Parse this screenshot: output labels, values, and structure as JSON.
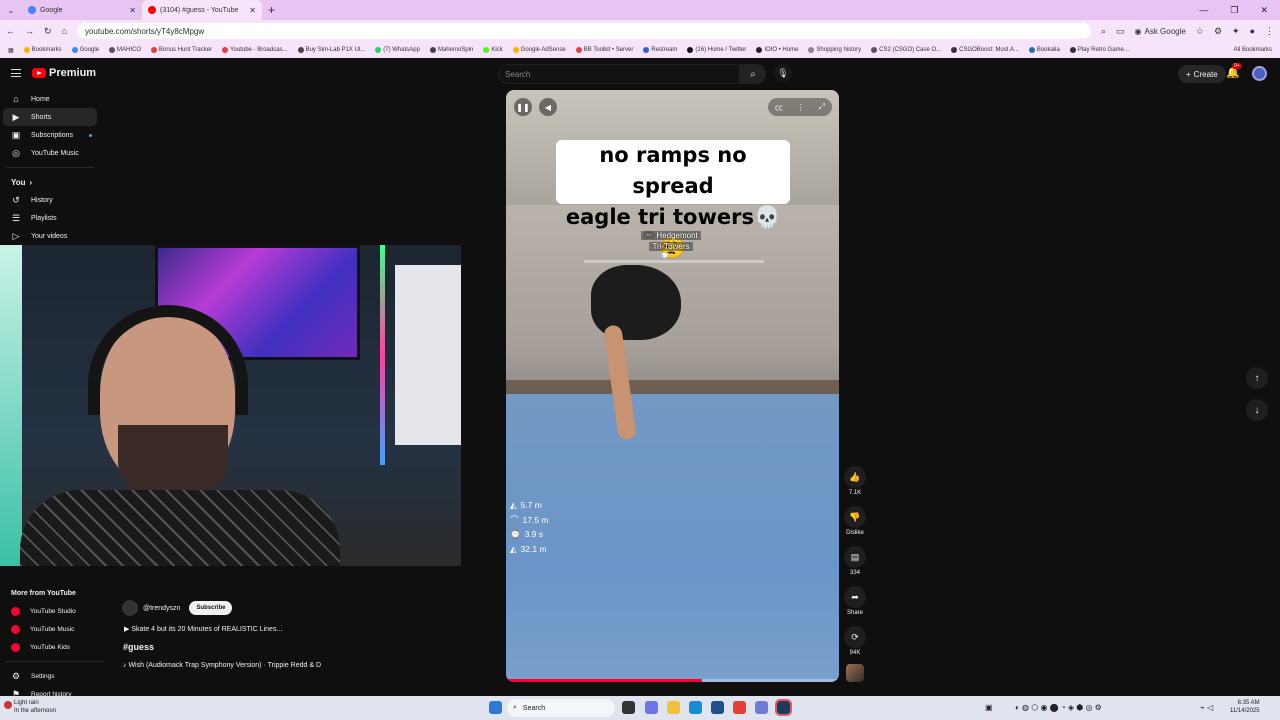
{
  "browser": {
    "tabs": [
      {
        "title": "Google",
        "color": "#4285f4",
        "active": false
      },
      {
        "title": "(3104) #guess - YouTube",
        "color": "#ff0000",
        "active": true
      }
    ],
    "url": "youtube.com/shorts/yT4y8cMpgw",
    "ask_google": "Ask Google",
    "bookmarks": [
      "Bookmarks",
      "Google",
      "MAHICO",
      "Bonus Hunt Tracker",
      "Youtube - Broadcas...",
      "Buy Sim-Lab P1X Ul...",
      "(7) WhatsApp",
      "MahemoSpin",
      "Kick",
      "Google AdSense",
      "BB Toolkit • Server",
      "Restream",
      "(16) Home / Twitter",
      "IOIO • Home",
      "Shopping history",
      "CS2 (CSGO) Case O...",
      "CSGOBoost: Most A...",
      "Bookalia",
      "Play Retro Game..."
    ],
    "all_bookmarks": "All Bookmarks"
  },
  "header": {
    "logo": "Premium",
    "search_placeholder": "Search",
    "create": "Create",
    "notif_badge": "9+"
  },
  "sidebar": {
    "items": [
      {
        "label": "Home",
        "icon": "home-icon",
        "glyph": "⌂"
      },
      {
        "label": "Shorts",
        "icon": "shorts-icon",
        "glyph": "▶"
      },
      {
        "label": "Subscriptions",
        "icon": "subscriptions-icon",
        "glyph": "▣"
      },
      {
        "label": "YouTube Music",
        "icon": "music-icon",
        "glyph": "◎"
      }
    ],
    "you_label": "You",
    "you_items": [
      {
        "label": "History",
        "icon": "history-icon",
        "glyph": "↺"
      },
      {
        "label": "Playlists",
        "icon": "playlists-icon",
        "glyph": "☰"
      },
      {
        "label": "Your videos",
        "icon": "your-videos-icon",
        "glyph": "▷"
      }
    ],
    "more_label": "More from YouTube",
    "more_items": [
      {
        "label": "YouTube Studio"
      },
      {
        "label": "YouTube Music"
      },
      {
        "label": "YouTube Kids"
      }
    ],
    "settings": "Settings",
    "report_history": "Report history"
  },
  "short": {
    "caption_line1": "no ramps no spread",
    "caption_line2": "eagle tri towers💀😮‍💨",
    "game_tag_user": "🎮 Hedgemont",
    "game_tag_spot": "Tri-Towers",
    "stats": [
      {
        "icon": "◭",
        "value": "5.7 m"
      },
      {
        "icon": "⌒",
        "value": "17.5 m"
      },
      {
        "icon": "⌚",
        "value": "3.9 s"
      },
      {
        "icon": "◭",
        "value": "32.1 m"
      }
    ],
    "progress": 0.59,
    "channel": "@trendyszn",
    "subscribe": "Subscribe",
    "video_title": "▶  Skate 4 but its 20 Minutes of REALISTIC Lines...",
    "hashtag": "#guess",
    "song": "♪  Wish (Audiomack Trap Symphony Version) · Trippie Redd & D"
  },
  "actions": {
    "likes": "7.1K",
    "dislike": "Dislike",
    "comments": "334",
    "share": "Share",
    "remix": "94K"
  },
  "taskbar": {
    "weather_line1": "Light rain",
    "weather_line2": "In the afternoon",
    "search": "Search",
    "time": "6:35 AM",
    "date": "11/14/2025"
  }
}
